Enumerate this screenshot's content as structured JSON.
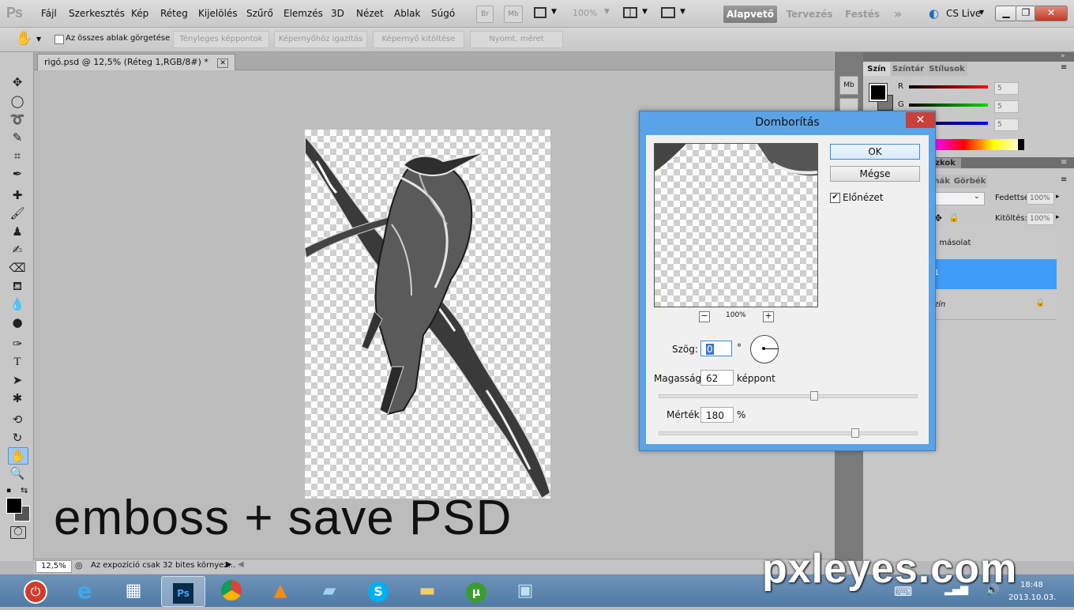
{
  "app": {
    "logo": "Ps"
  },
  "menu": [
    "Fájl",
    "Szerkesztés",
    "Kép",
    "Réteg",
    "Kijelölés",
    "Szűrő",
    "Elemzés",
    "3D",
    "Nézet",
    "Ablak",
    "Súgó"
  ],
  "toolbar": {
    "br": "Br",
    "mb": "Mb",
    "zoom": "100%"
  },
  "workspaces": {
    "active": "Alapvető",
    "design": "Tervezés",
    "paint": "Festés",
    "more": "»",
    "cslive": "CS Live"
  },
  "options": {
    "scroll_all": "Az összes ablak görgetése",
    "actual_pixels": "Tényleges képpontok",
    "fit_screen": "Képernyőhöz igazítás",
    "fill_screen": "Képernyő kitöltése",
    "print_size": "Nyomt. méret"
  },
  "document": {
    "tab_title": "rigó.psd @ 12,5% (Réteg 1,RGB/8#) *",
    "close": "✕"
  },
  "caption": "emboss  + save PSD",
  "status": {
    "zoom": "12,5%",
    "message": "Az expozíció csak 32 bites környez..."
  },
  "color_panel": {
    "tabs": [
      "Szín",
      "Színtár",
      "Stílusok"
    ],
    "channels": [
      {
        "label": "R",
        "value": "5"
      },
      {
        "label": "G",
        "value": "5"
      },
      {
        "label": "B",
        "value": "5"
      }
    ]
  },
  "layers_panel": {
    "tabs": [
      "zkok",
      "mák",
      "Görbék"
    ],
    "opacity_label": "Fedettség:",
    "opacity_value": "100%",
    "fill_label": "Kitöltés:",
    "fill_value": "100%",
    "layers": [
      {
        "name": ". másolat"
      },
      {
        "name": "1"
      },
      {
        "name": "zín"
      }
    ]
  },
  "dialog": {
    "title": "Domborítás",
    "close": "✕",
    "ok": "OK",
    "cancel": "Mégse",
    "preview_label": "Előnézet",
    "preview_zoom": "100%",
    "minus": "−",
    "plus": "+",
    "angle_label": "Szög:",
    "angle_value": "0",
    "angle_unit": "°",
    "height_label": "Magasság:",
    "height_value": "62",
    "height_unit": "képpont",
    "height_slider": 0.6,
    "amount_label": "Mérték:",
    "amount_value": "180",
    "amount_unit": "%",
    "amount_slider": 0.76
  },
  "taskbar": {
    "date": "2013.10.03.",
    "time": "18:48"
  },
  "watermark": "pxleyes.com",
  "colors": {
    "accent": "#3f9cf7",
    "dialog_frame": "#5aa3e6",
    "close_red": "#c8403a"
  }
}
